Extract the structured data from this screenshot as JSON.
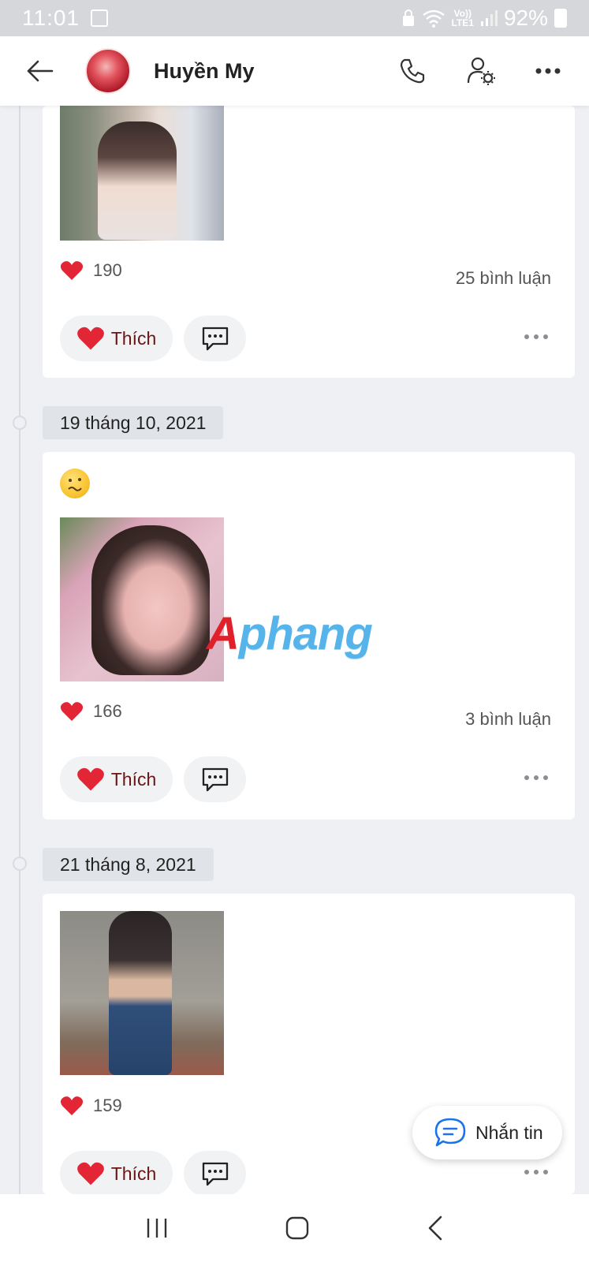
{
  "status_bar": {
    "time": "11:01",
    "signal_label_top": "Vo))",
    "signal_label_bottom": "LTE1",
    "battery": "92%"
  },
  "header": {
    "title": "Huyền My"
  },
  "posts": [
    {
      "likes": "190",
      "comments": "25 bình luận",
      "like_label": "Thích"
    },
    {
      "date": "19 tháng 10, 2021",
      "likes": "166",
      "comments": "3 bình luận",
      "like_label": "Thích"
    },
    {
      "date": "21 tháng 8, 2021",
      "likes": "159",
      "like_label": "Thích"
    }
  ],
  "fab": {
    "label": "Nhắn tin"
  },
  "watermark": {
    "first": "A",
    "rest": "phang"
  },
  "colors": {
    "accent": "#1a73e8",
    "heart": "#e32636",
    "like_text": "#6b1414"
  }
}
